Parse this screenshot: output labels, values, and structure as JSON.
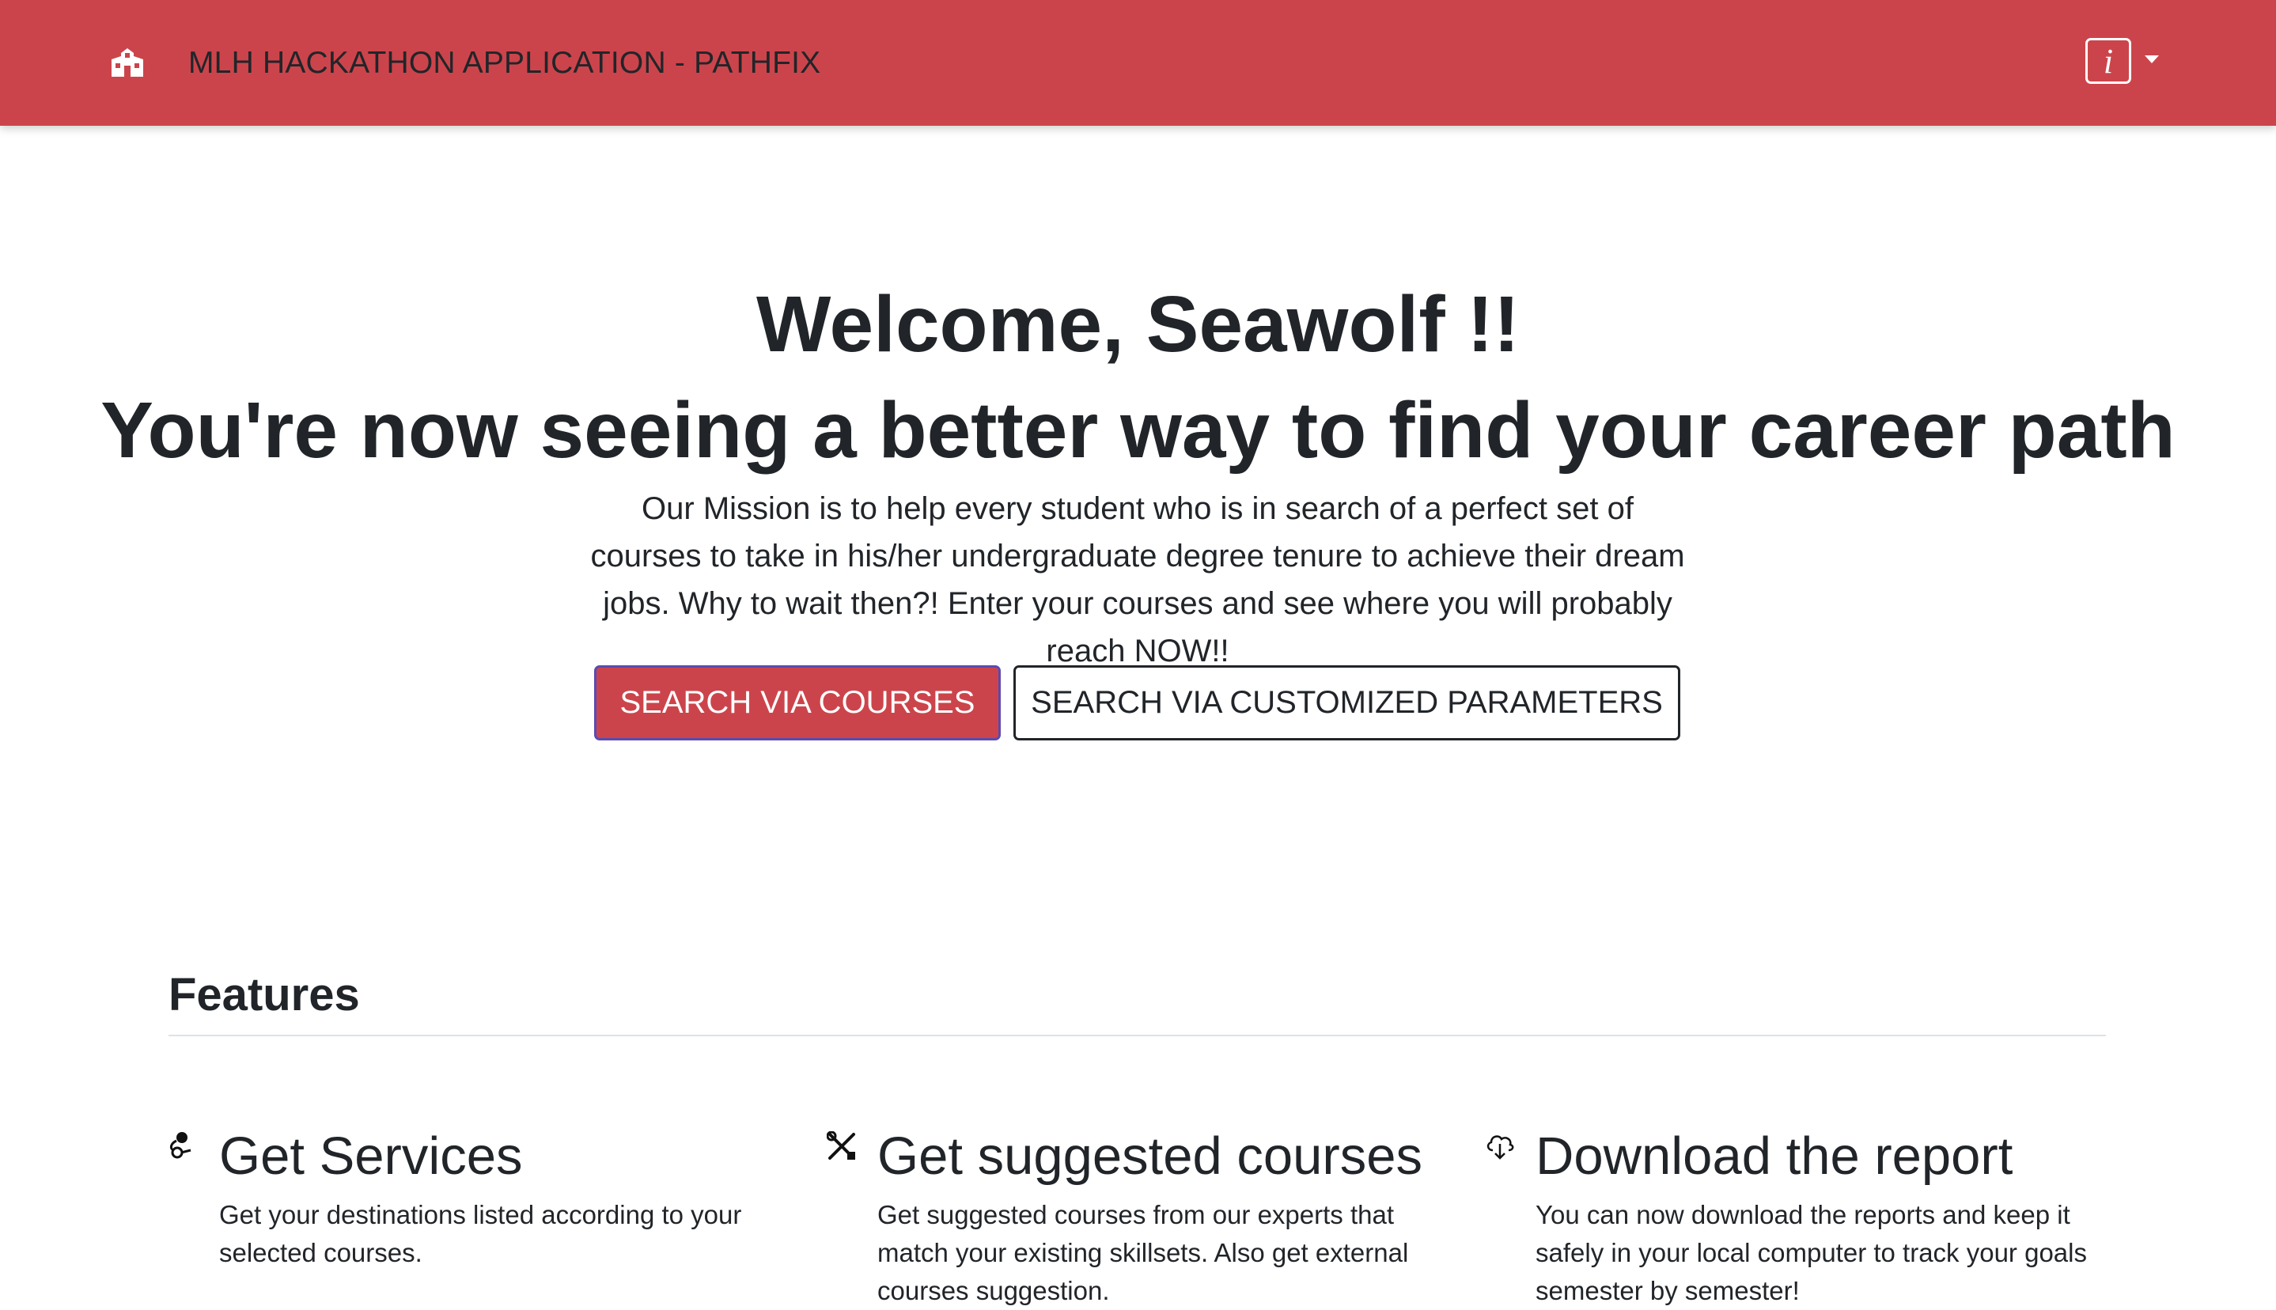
{
  "navbar": {
    "brand_icon": "school-building-icon",
    "title": "MLH HACKATHON APPLICATION - PATHFIX",
    "info_button": {
      "icon": "info-icon",
      "glyph": "i"
    },
    "dropdown_icon": "caret-down-icon",
    "background_color": "#cc444b"
  },
  "hero": {
    "welcome": "Welcome, Seawolf !!",
    "tagline": "You're now seeing a better way to find your career path",
    "mission": "Our Mission is to help every student who is in search of a perfect set of courses to take in his/her undergraduate degree tenure to achieve their dream jobs. Why to wait then?! Enter your courses and see where you will probably reach NOW!!",
    "buttons": {
      "primary": "SEARCH VIA COURSES",
      "secondary": "SEARCH VIA CUSTOMIZED PARAMETERS"
    }
  },
  "features": {
    "heading": "Features",
    "items": [
      {
        "icon": "nodes-icon",
        "title": "Get Services",
        "description": "Get your destinations listed according to your selected courses."
      },
      {
        "icon": "tools-icon",
        "title": "Get suggested courses",
        "description": "Get suggested courses from our experts that match your existing skillsets. Also get external courses suggestion."
      },
      {
        "icon": "cloud-download-icon",
        "title": "Download the report",
        "description": "You can now download the reports and keep it safely in your local computer to track your goals semester by semester!"
      }
    ]
  },
  "colors": {
    "accent": "#cc444b",
    "text": "#212529",
    "primary_button_border": "#5a4bb0"
  }
}
